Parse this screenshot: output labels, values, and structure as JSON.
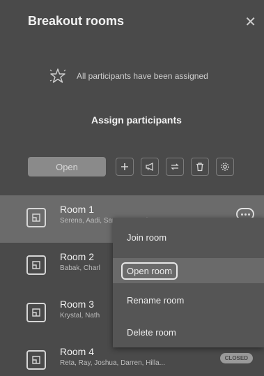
{
  "header": {
    "title": "Breakout rooms",
    "close_glyph": "✕"
  },
  "status": {
    "message": "All participants have been assigned",
    "icon": "star-icon"
  },
  "actions": {
    "assign_label": "Assign participants",
    "open_label": "Open"
  },
  "toolbar": {
    "tools": [
      {
        "name": "add-room-button",
        "icon": "plus-icon"
      },
      {
        "name": "announcement-button",
        "icon": "megaphone-icon"
      },
      {
        "name": "recreate-rooms-button",
        "icon": "refresh-icon"
      },
      {
        "name": "delete-rooms-button",
        "icon": "trash-icon"
      },
      {
        "name": "settings-button",
        "icon": "gear-icon"
      }
    ]
  },
  "rooms": [
    {
      "name": "Room 1",
      "participants": "Serena, Aadi, Sara, Tom, Ede"
    },
    {
      "name": "Room 2",
      "participants": "Babak, Charl"
    },
    {
      "name": "Room 3",
      "participants": "Krystal, Nath"
    },
    {
      "name": "Room 4",
      "participants": "Reta, Ray, Joshua, Darren, Hilla...",
      "badge": "CLOSED"
    }
  ],
  "context_menu": {
    "items": [
      "Join room",
      "Open room",
      "Rename room",
      "Delete room"
    ],
    "focused_index": 1
  }
}
